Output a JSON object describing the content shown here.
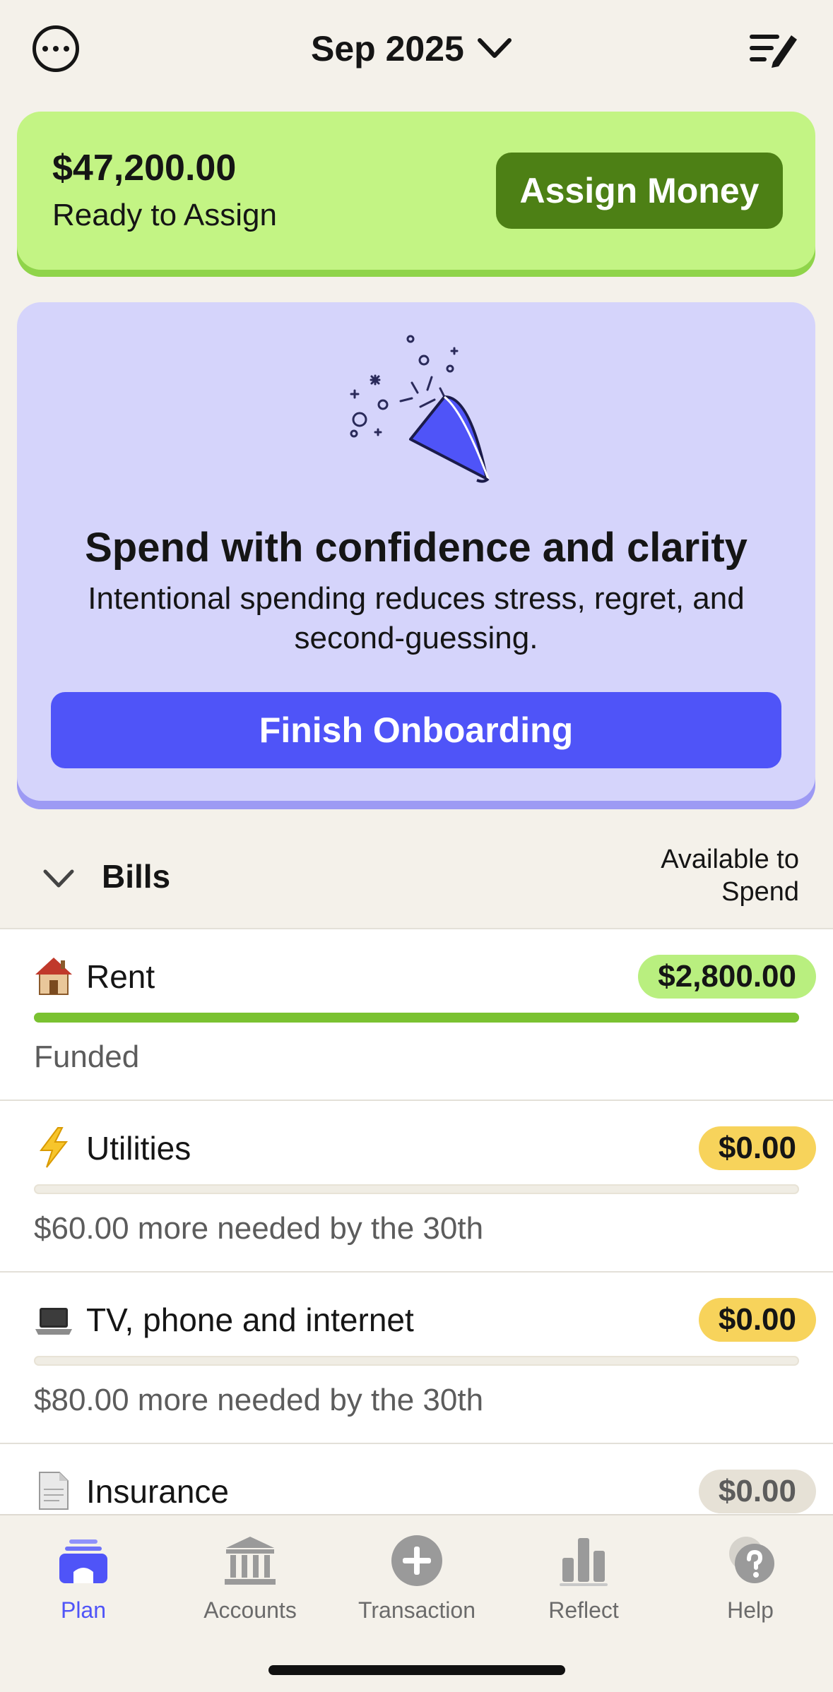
{
  "header": {
    "month": "Sep 2025",
    "more_icon": "ellipsis-circle-icon",
    "edit_icon": "edit-list-icon"
  },
  "assign": {
    "amount": "$47,200.00",
    "label": "Ready to Assign",
    "button": "Assign Money"
  },
  "onboarding": {
    "title": "Spend with confidence and clarity",
    "text": "Intentional spending reduces stress, regret, and second-guessing.",
    "button": "Finish Onboarding",
    "illustration": "party-popper-icon"
  },
  "group": {
    "name": "Bills",
    "column_label": "Available to Spend"
  },
  "categories": [
    {
      "emoji": "house-icon",
      "name": "Rent",
      "available": "$2,800.00",
      "status": "Funded",
      "funded_fraction": 1.0,
      "badge_color": "#b9ef7f"
    },
    {
      "emoji": "lightning-icon",
      "name": "Utilities",
      "available": "$0.00",
      "status": "$60.00 more needed by the 30th",
      "funded_fraction": 0,
      "badge_color": "#f7d35b"
    },
    {
      "emoji": "laptop-icon",
      "name": "TV, phone and internet",
      "available": "$0.00",
      "status": "$80.00 more needed by the 30th",
      "funded_fraction": 0,
      "badge_color": "#f7d35b"
    },
    {
      "emoji": "document-icon",
      "name": "Insurance",
      "available": "$0.00",
      "status": "",
      "funded_fraction": 0,
      "badge_color": "#e6e1d6"
    }
  ],
  "tabs": [
    {
      "label": "Plan",
      "icon": "plan-icon",
      "active": true
    },
    {
      "label": "Accounts",
      "icon": "bank-icon",
      "active": false
    },
    {
      "label": "Transaction",
      "icon": "plus-circle-icon",
      "active": false
    },
    {
      "label": "Reflect",
      "icon": "bar-chart-icon",
      "active": false
    },
    {
      "label": "Help",
      "icon": "help-bubble-icon",
      "active": false
    }
  ],
  "colors": {
    "accent": "#4f54f8",
    "assign_bg": "#c3f484",
    "assign_button": "#4d8015",
    "onboard_bg": "#d5d4fb",
    "funded_bar": "#7ac231"
  }
}
